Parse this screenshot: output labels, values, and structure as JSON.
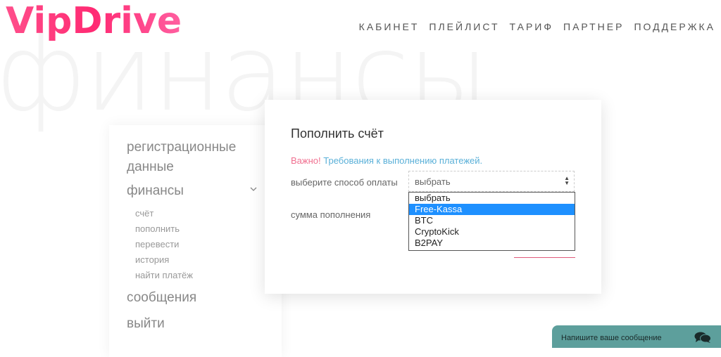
{
  "brand": {
    "logo": "VipDrive"
  },
  "background_word": "финансы",
  "nav": [
    "КАБИНЕТ",
    "ПЛЕЙЛИСТ",
    "ТАРИФ",
    "ПАРТНЕР",
    "ПОДДЕРЖКА"
  ],
  "sidebar": {
    "registration": "регистрационные данные",
    "finance": "финансы",
    "sub": [
      "счёт",
      "пополнить",
      "перевести",
      "история",
      "найти платёж"
    ],
    "messages": "сообщения",
    "logout": "выйти"
  },
  "card": {
    "title": "Пополнить счёт",
    "important": "Важно!",
    "requirements": "Требования к выполнению платежей.",
    "method_label": "выберите способ оплаты",
    "amount_label": "сумма пополнения",
    "select_value": "выбрать",
    "options": [
      "выбрать",
      "Free-Kassa",
      "BTC",
      "CryptoKick",
      "B2PAY"
    ],
    "highlighted_option": "Free-Kassa"
  },
  "chat": {
    "placeholder": "Напишите ваше сообщение",
    "icon": "chat-bubbles-icon"
  },
  "colors": {
    "accent": "#ff2a73",
    "link": "#5ab0d8",
    "highlight": "#1e90ff",
    "chat": "#5d9f9c"
  }
}
